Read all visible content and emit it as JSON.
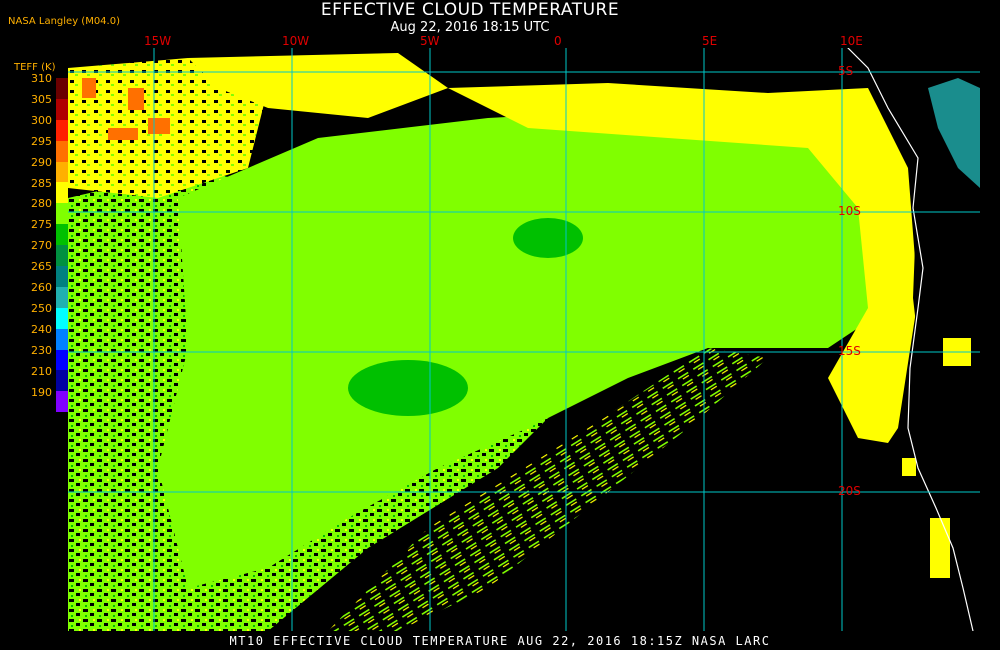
{
  "header": {
    "title": "EFFECTIVE CLOUD TEMPERATURE",
    "subtitle": "Aug 22, 2016 18:15 UTC",
    "agency": "NASA Langley (M04.0)"
  },
  "legend": {
    "title": "TEFF (K)",
    "labels": [
      "310",
      "305",
      "300",
      "295",
      "290",
      "285",
      "280",
      "275",
      "270",
      "265",
      "260",
      "250",
      "240",
      "230",
      "210",
      "190"
    ],
    "colors": [
      "#6a0000",
      "#b00000",
      "#ff2000",
      "#ff7000",
      "#ffb000",
      "#ffff00",
      "#80ff00",
      "#00c000",
      "#009040",
      "#008080",
      "#20b0b0",
      "#00ffff",
      "#0080ff",
      "#0000ff",
      "#0000a0",
      "#8000ff"
    ]
  },
  "map": {
    "lon_labels": [
      "15W",
      "10W",
      "5W",
      "0",
      "5E",
      "10E"
    ],
    "lat_labels": [
      "5S",
      "10S",
      "15S",
      "20S"
    ],
    "grid_color": "#00c8c8",
    "coast_color": "#ffffff"
  },
  "footer": {
    "text": "MT10   EFFECTIVE CLOUD TEMPERATURE   AUG 22, 2016 18:15Z   NASA LARC"
  }
}
